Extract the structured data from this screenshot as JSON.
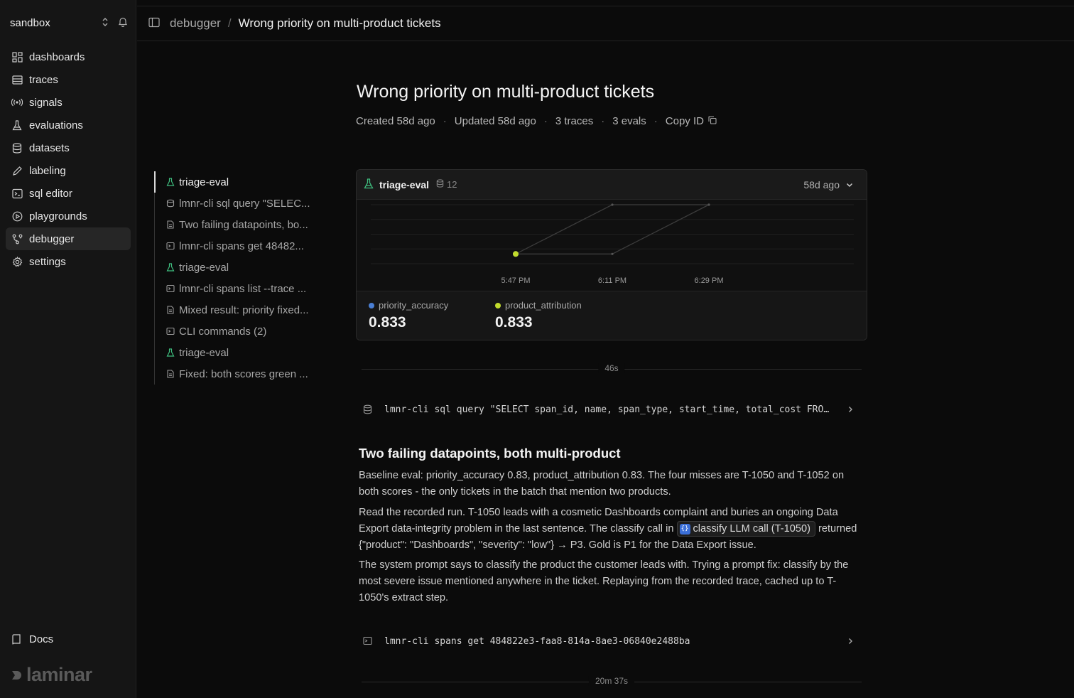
{
  "workspace": {
    "name": "sandbox"
  },
  "sidebar": {
    "items": [
      {
        "label": "dashboards",
        "icon": "grid-icon"
      },
      {
        "label": "traces",
        "icon": "list-icon"
      },
      {
        "label": "signals",
        "icon": "broadcast-icon"
      },
      {
        "label": "evaluations",
        "icon": "flask-icon"
      },
      {
        "label": "datasets",
        "icon": "database-icon"
      },
      {
        "label": "labeling",
        "icon": "pen-icon"
      },
      {
        "label": "sql editor",
        "icon": "terminal-icon"
      },
      {
        "label": "playgrounds",
        "icon": "play-icon"
      },
      {
        "label": "debugger",
        "icon": "share-nodes-icon",
        "active": true
      },
      {
        "label": "settings",
        "icon": "gear-icon"
      }
    ],
    "docs_label": "Docs",
    "brand": "laminar"
  },
  "breadcrumb": {
    "parent": "debugger",
    "separator": "/",
    "current": "Wrong priority on multi-product tickets"
  },
  "page": {
    "title": "Wrong priority on multi-product tickets",
    "meta": {
      "created": "Created 58d ago",
      "updated": "Updated 58d ago",
      "traces": "3 traces",
      "evals": "3 evals",
      "copy_id": "Copy ID"
    }
  },
  "outline": [
    {
      "label": "triage-eval",
      "icon": "flask-icon",
      "active": true
    },
    {
      "label": "lmnr-cli sql query \"SELEC...",
      "icon": "sql-icon"
    },
    {
      "label": "Two failing datapoints, bo...",
      "icon": "document-icon"
    },
    {
      "label": "lmnr-cli spans get 48482...",
      "icon": "terminal-icon"
    },
    {
      "label": "triage-eval",
      "icon": "flask-icon"
    },
    {
      "label": "lmnr-cli spans list --trace ...",
      "icon": "terminal-icon"
    },
    {
      "label": "Mixed result: priority fixed...",
      "icon": "document-icon"
    },
    {
      "label": "CLI commands (2)",
      "icon": "terminal-icon"
    },
    {
      "label": "triage-eval",
      "icon": "flask-icon"
    },
    {
      "label": "Fixed: both scores green ...",
      "icon": "document-icon"
    }
  ],
  "eval_card": {
    "name": "triage-eval",
    "datapoint_count": "12",
    "time": "58d ago",
    "colors": {
      "priority_accuracy": "#4a7fd4",
      "product_attribution": "#c2dc2c"
    },
    "metrics": [
      {
        "name": "priority_accuracy",
        "value": "0.833",
        "color": "#4a7fd4"
      },
      {
        "name": "product_attribution",
        "value": "0.833",
        "color": "#c2dc2c"
      }
    ]
  },
  "chart_data": {
    "type": "line",
    "categories": [
      "5:47 PM",
      "6:11 PM",
      "6:29 PM"
    ],
    "series": [
      {
        "name": "priority_accuracy",
        "values": [
          0.833,
          1.0,
          1.0
        ]
      },
      {
        "name": "product_attribution",
        "values": [
          0.833,
          0.833,
          1.0
        ]
      }
    ],
    "ylim": [
      0.8,
      1.0
    ],
    "grid": true
  },
  "timeline": [
    {
      "label": "46s"
    },
    {
      "label": "20m 37s"
    }
  ],
  "commands": [
    {
      "text": "lmnr-cli sql query \"SELECT span_id, name, span_type, start_time, total_cost FROM spans WHERE trace_id = ...\"",
      "icon": "sql-icon"
    },
    {
      "text": "lmnr-cli spans get 484822e3-faa8-814a-8ae3-06840e2488ba",
      "icon": "terminal-icon"
    }
  ],
  "note": {
    "title": "Two failing datapoints, both multi-product",
    "p1": "Baseline eval: priority_accuracy 0.83, product_attribution 0.83. The four misses are T-1050 and T-1052 on both scores - the only tickets in the batch that mention two products.",
    "p2_before": "Read the recorded run. T-1050 leads with a cosmetic Dashboards complaint and buries an ongoing Data Export data-integrity problem in the last sentence. The classify call in ",
    "p2_chip": "classify LLM call (T-1050)",
    "p2_after": " returned {\"product\": \"Dashboards\", \"severity\": \"low\"} → P3. Gold is P1 for the Data Export issue.",
    "p3": "The system prompt says to classify the product the customer leads with. Trying a prompt fix: classify by the most severe issue mentioned anywhere in the ticket. Replaying from the recorded trace, cached up to T-1050's extract step."
  }
}
